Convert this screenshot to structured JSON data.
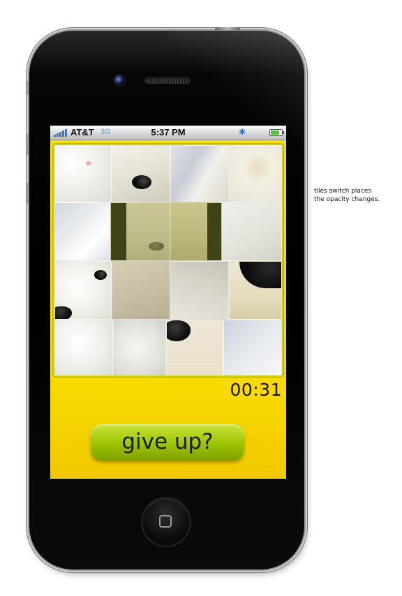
{
  "status_bar": {
    "carrier": "AT&T",
    "network": "3G",
    "time": "5:37 PM",
    "bluetooth_icon": "bluetooth-icon",
    "battery_icon": "battery-icon",
    "signal_icon": "signal-bars-icon"
  },
  "puzzle": {
    "rows": 4,
    "cols": 4,
    "tiles": [
      {
        "id": "r1c1",
        "content": "fur"
      },
      {
        "id": "r1c2",
        "content": "eye"
      },
      {
        "id": "r1c3",
        "content": "fur"
      },
      {
        "id": "r1c4",
        "content": "ear"
      },
      {
        "id": "r2c1",
        "content": "fur"
      },
      {
        "id": "r2c2",
        "content": "snout-faded"
      },
      {
        "id": "r2c3",
        "content": "snout-faded"
      },
      {
        "id": "r2c4",
        "content": "fur"
      },
      {
        "id": "r3c1",
        "content": "eye"
      },
      {
        "id": "r3c2",
        "content": "fur"
      },
      {
        "id": "r3c3",
        "content": "fur"
      },
      {
        "id": "r3c4",
        "content": "mouth"
      },
      {
        "id": "r4c1",
        "content": "fur"
      },
      {
        "id": "r4c2",
        "content": "fur"
      },
      {
        "id": "r4c3",
        "content": "nose"
      },
      {
        "id": "r4c4",
        "content": "snow"
      }
    ]
  },
  "timer": "00:31",
  "give_up_label": "give up?",
  "annotation": {
    "line1": "tiles switch places",
    "line2": "the opacity changes."
  },
  "colors": {
    "screen_yellow": "#f6e000",
    "button_green": "#9cc400",
    "phone_black": "#000000"
  }
}
